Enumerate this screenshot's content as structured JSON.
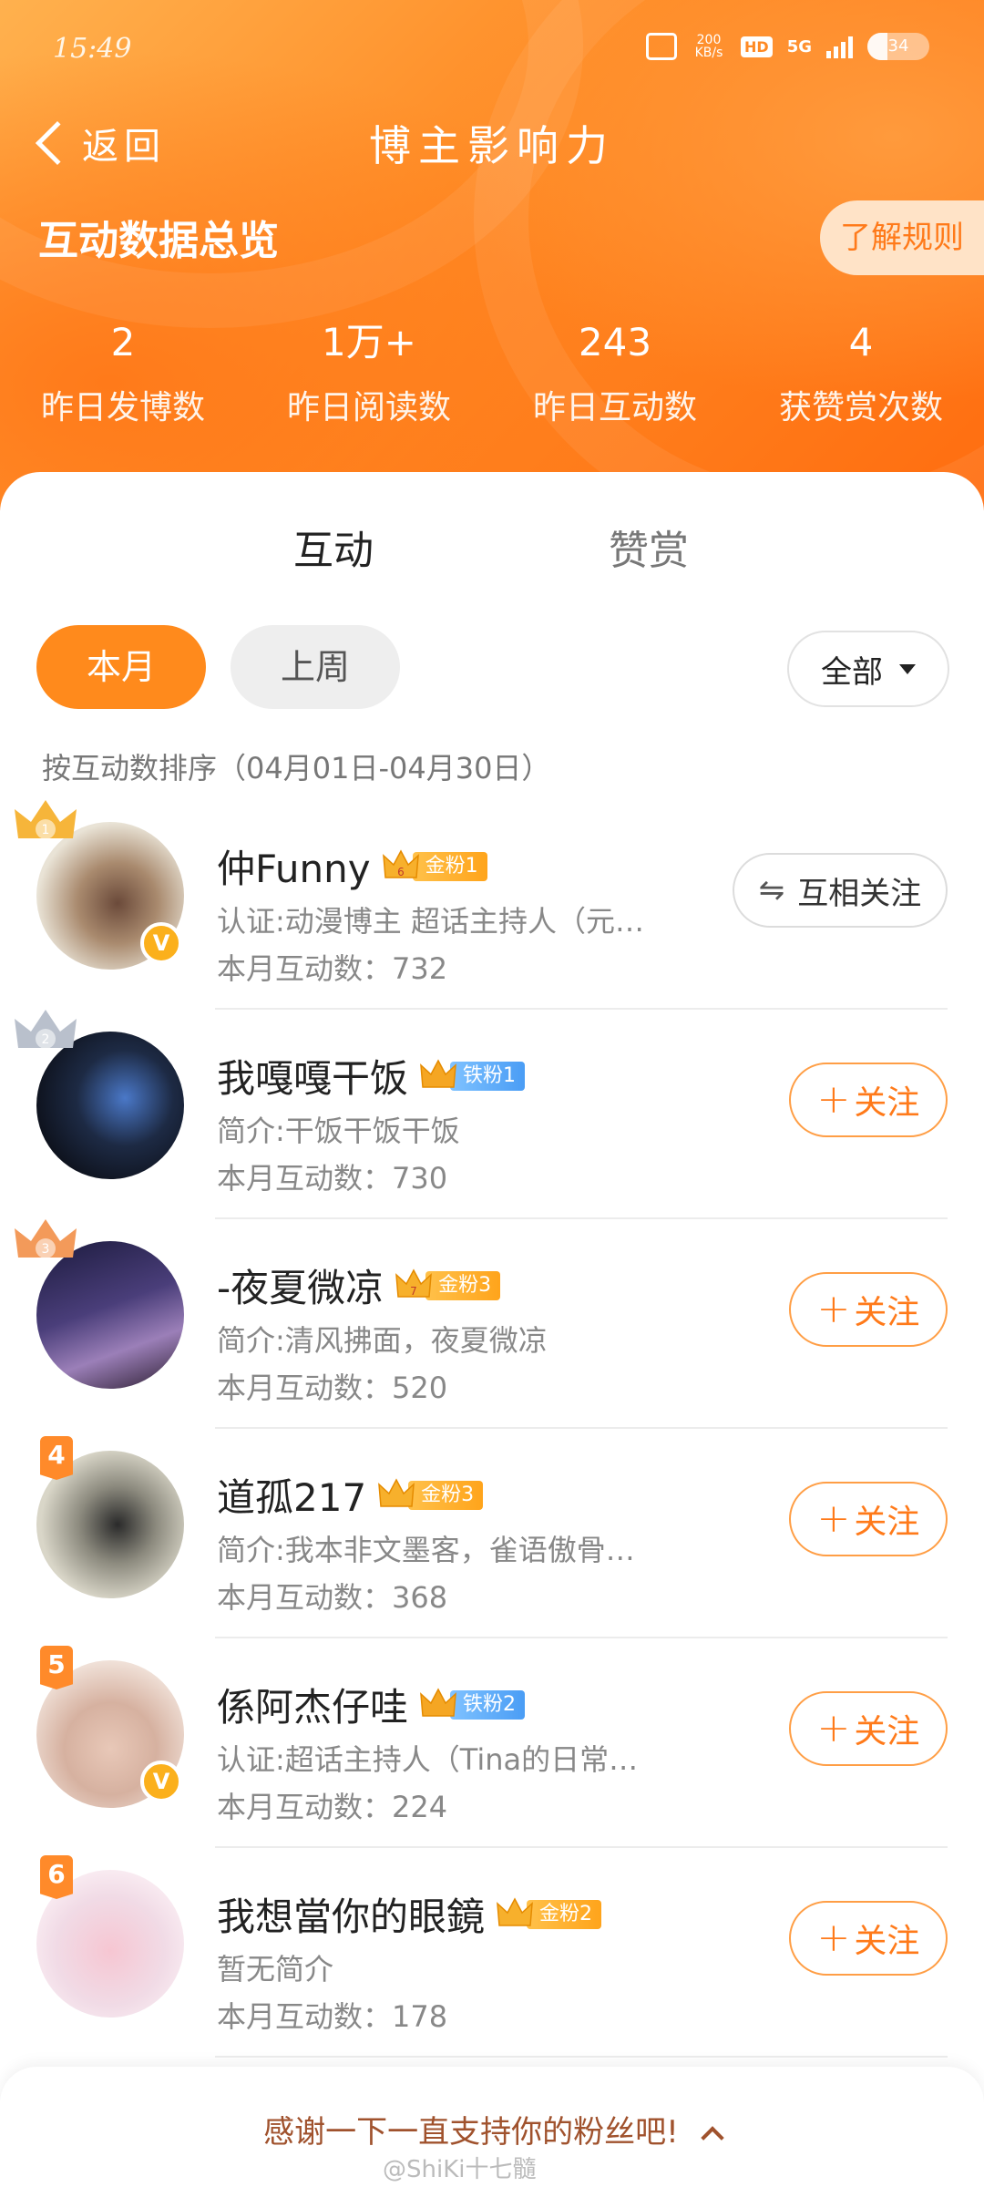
{
  "status_bar": {
    "time": "15:49",
    "net_speed": "200\nKB/s",
    "hd": "HD",
    "network": "5G",
    "battery": "34"
  },
  "topbar": {
    "back_label": "返回",
    "title": "博主影响力"
  },
  "overview": {
    "title": "互动数据总览",
    "rules_button": "了解规则",
    "stats": [
      {
        "value": "2",
        "label": "昨日发博数"
      },
      {
        "value": "1万+",
        "label": "昨日阅读数"
      },
      {
        "value": "243",
        "label": "昨日互动数"
      },
      {
        "value": "4",
        "label": "获赞赏次数"
      }
    ]
  },
  "tabs": [
    {
      "label": "互动",
      "active": true
    },
    {
      "label": "赞赏",
      "active": false
    }
  ],
  "period": {
    "this_month": "本月",
    "last_week": "上周",
    "filter": "全部"
  },
  "sort_note": "按互动数排序（04月01日-04月30日）",
  "users": [
    {
      "rank": "1",
      "name": "仲Funny",
      "fan_level": "6",
      "fan_tag": "金粉1",
      "tag_type": "gold",
      "desc": "认证:动漫博主 超话主持人（元…",
      "count": "本月互动数：732",
      "verified": true,
      "action": "互相关注",
      "mutual": true
    },
    {
      "rank": "2",
      "name": "我嘎嘎干饭",
      "fan_level": "",
      "fan_tag": "铁粉1",
      "tag_type": "iron",
      "desc": "简介:干饭干饭干饭",
      "count": "本月互动数：730",
      "verified": false,
      "action": "关注",
      "mutual": false
    },
    {
      "rank": "3",
      "name": "-夜夏微凉",
      "fan_level": "7",
      "fan_tag": "金粉3",
      "tag_type": "gold",
      "desc": "简介:清风拂面，夜夏微凉",
      "count": "本月互动数：520",
      "verified": false,
      "action": "关注",
      "mutual": false
    },
    {
      "rank": "4",
      "name": "道孤217",
      "fan_level": "",
      "fan_tag": "金粉3",
      "tag_type": "gold",
      "desc": "简介:我本非文墨客，雀语傲骨…",
      "count": "本月互动数：368",
      "verified": false,
      "action": "关注",
      "mutual": false
    },
    {
      "rank": "5",
      "name": "係阿杰仔哇",
      "fan_level": "",
      "fan_tag": "铁粉2",
      "tag_type": "iron",
      "desc": "认证:超话主持人（Tina的日常…",
      "count": "本月互动数：224",
      "verified": true,
      "action": "关注",
      "mutual": false
    },
    {
      "rank": "6",
      "name": "我想當你的眼鏡",
      "fan_level": "",
      "fan_tag": "金粉2",
      "tag_type": "gold",
      "desc": "暂无简介",
      "count": "本月互动数：178",
      "verified": false,
      "action": "关注",
      "mutual": false
    }
  ],
  "footer": {
    "text": "感谢一下一直支持你的粉丝吧!"
  },
  "watermark": "@ShiKi十七髓",
  "colors": {
    "accent": "#ff8a1c",
    "follow": "#ff7a1a",
    "gold_tag": "#ffb02a",
    "iron_tag": "#5aa8f8"
  }
}
